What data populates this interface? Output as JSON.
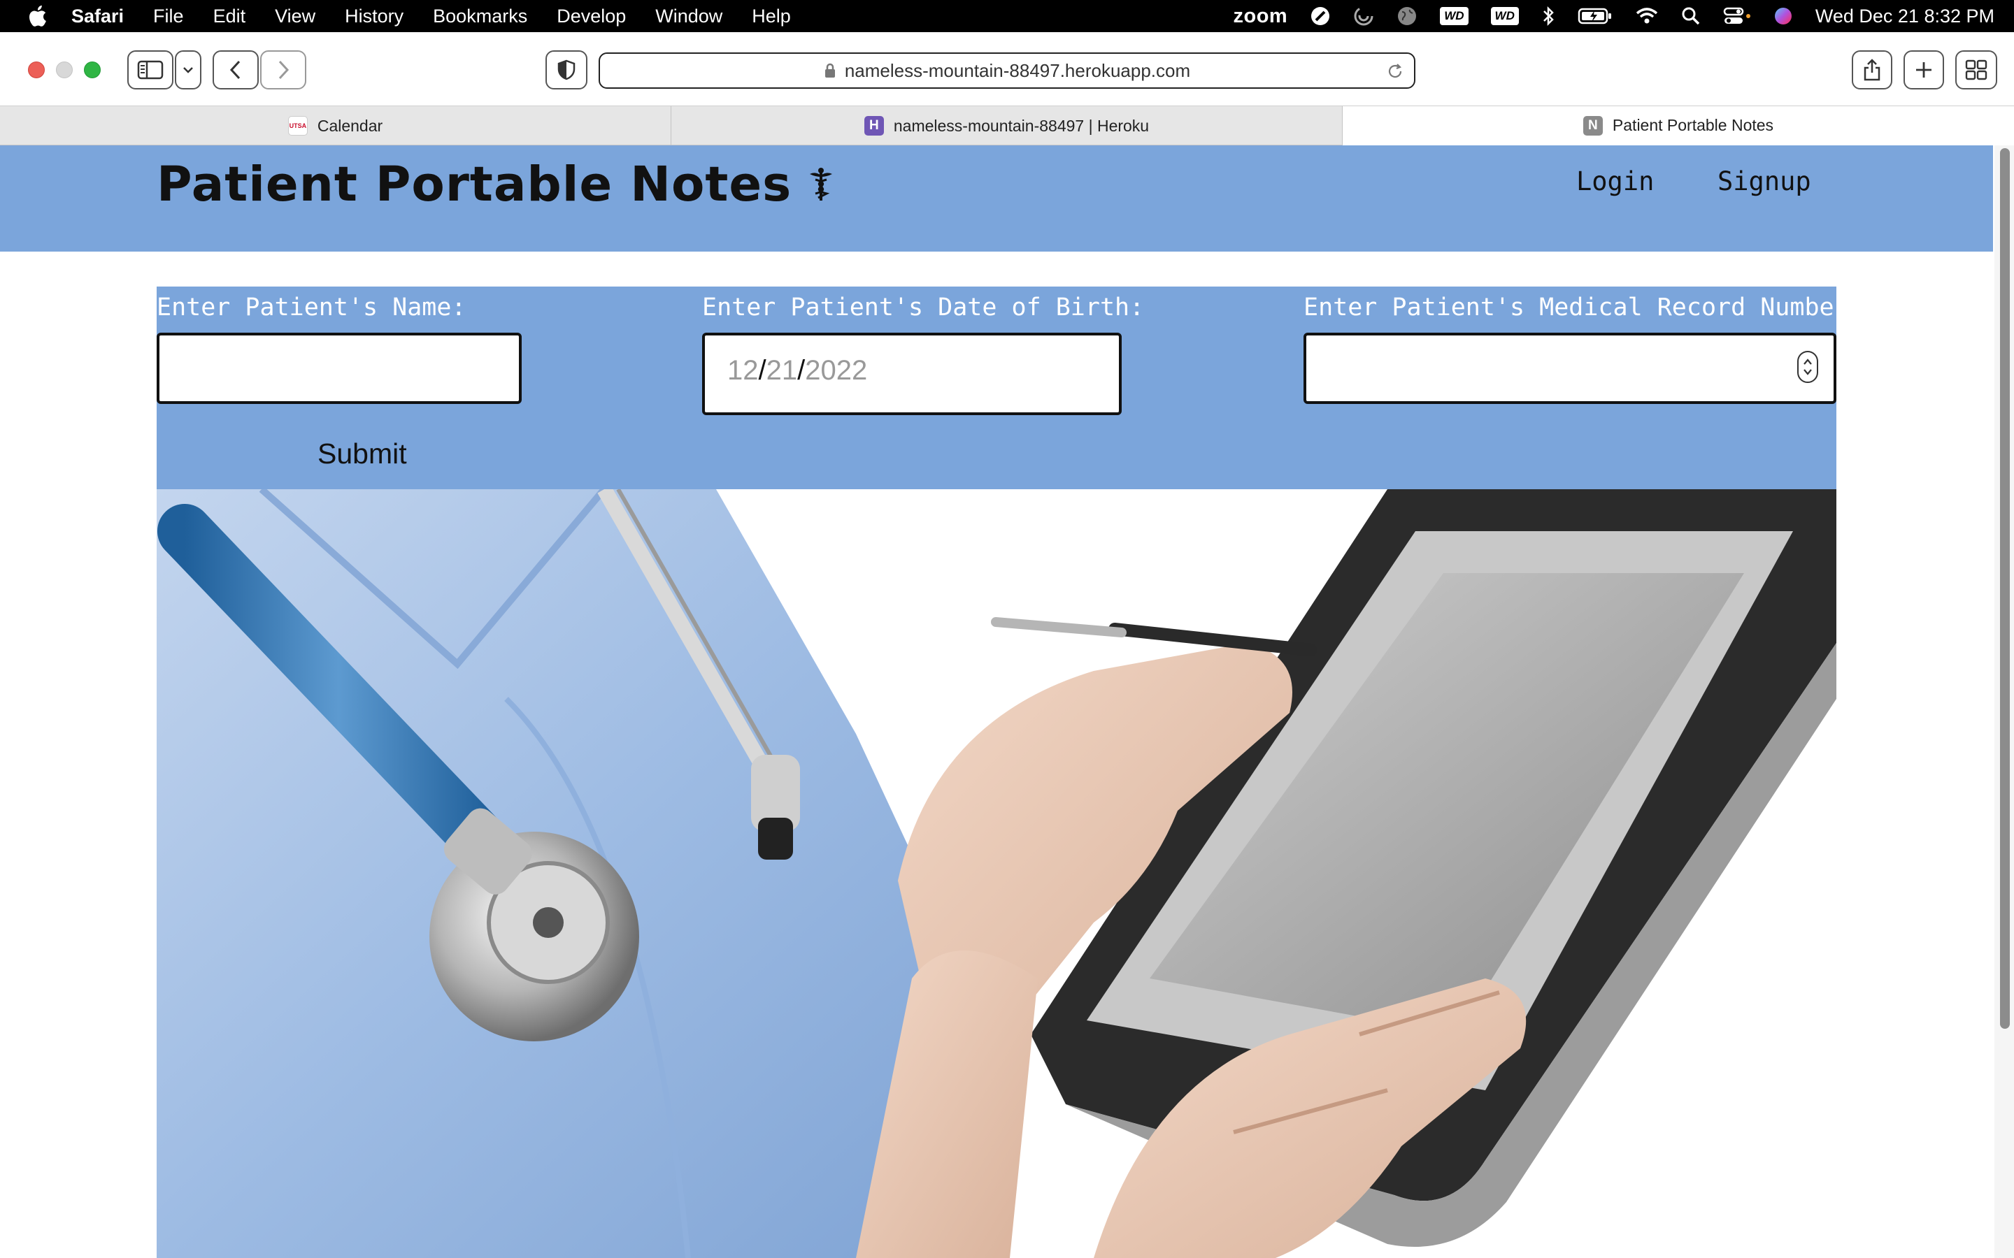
{
  "menubar": {
    "app_name": "Safari",
    "menus": [
      "File",
      "Edit",
      "View",
      "History",
      "Bookmarks",
      "Develop",
      "Window",
      "Help"
    ],
    "zoom_label": "zoom",
    "wd_label_1": "WD",
    "wd_label_2": "WD",
    "clock": "Wed Dec 21  8:32 PM"
  },
  "browser": {
    "url": "nameless-mountain-88497.herokuapp.com",
    "tabs": [
      {
        "label": "Calendar",
        "favicon_text": "UTSA"
      },
      {
        "label": "nameless-mountain-88497 | Heroku",
        "favicon_text": "H"
      },
      {
        "label": "Patient Portable Notes",
        "favicon_text": "N"
      }
    ]
  },
  "site": {
    "title": "Patient Portable Notes",
    "nav": {
      "login": "Login",
      "signup": "Signup"
    },
    "colors": {
      "header": "#7ba5db"
    }
  },
  "form": {
    "name_label": "Enter Patient's Name:",
    "name_value": "",
    "dob_label": "Enter Patient's Date of Birth:",
    "dob_month": "12",
    "dob_day": "21",
    "dob_year": "2022",
    "dob_sep": "/",
    "mrn_label": "Enter Patient's Medical Record Number:",
    "mrn_value": "",
    "submit_label": "Submit"
  }
}
